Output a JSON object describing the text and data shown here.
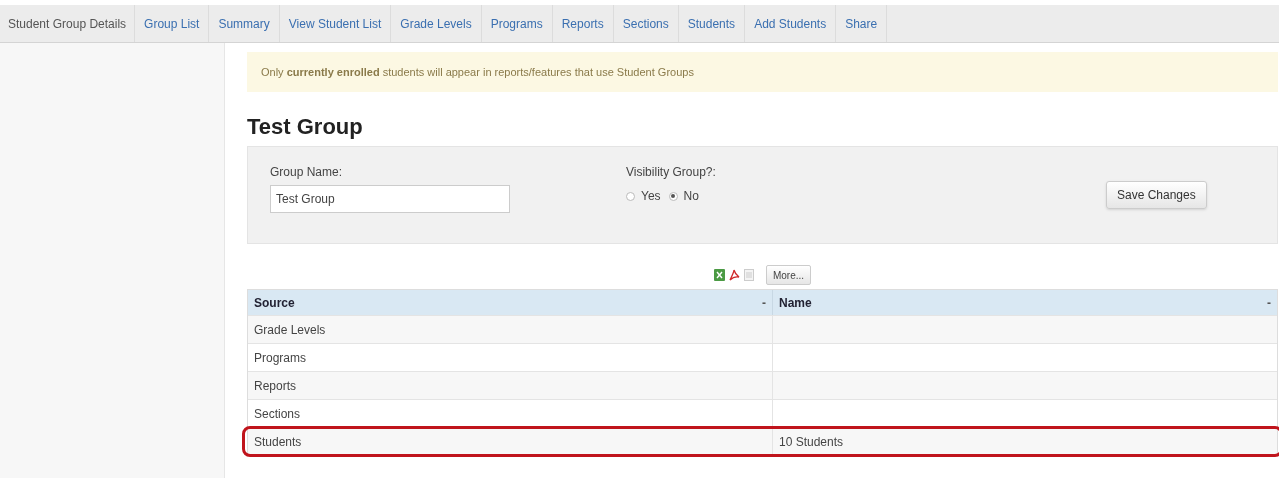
{
  "nav": {
    "title": "Student Group Details",
    "links": [
      "Group List",
      "Summary",
      "View Student List",
      "Grade Levels",
      "Programs",
      "Reports",
      "Sections",
      "Students",
      "Add Students",
      "Share"
    ]
  },
  "notice": "Only **currently enrolled** students will appear in reports/features that use Student Groups",
  "heading": "Test Group",
  "form": {
    "group_name": {
      "label": "Group Name:",
      "value": "Test Group"
    },
    "visibility": {
      "label": "Visibility Group?:",
      "options": [
        {
          "label": "Yes",
          "selected": false
        },
        {
          "label": "No",
          "selected": true
        }
      ]
    },
    "save_button": "Save Changes"
  },
  "export": {
    "more_button": "More..."
  },
  "table": {
    "columns": [
      {
        "label": "Source",
        "sort": "-"
      },
      {
        "label": "Name",
        "sort": "-"
      }
    ],
    "rows": [
      {
        "source": "Grade Levels",
        "highlighted": false
      },
      {
        "source": "Programs",
        "highlighted": false
      },
      {
        "source": "Reports",
        "highlighted": false
      },
      {
        "source": "Sections",
        "highlighted": false
      },
      {
        "source": "Students",
        "name": "10 Students",
        "highlighted": true
      }
    ]
  }
}
